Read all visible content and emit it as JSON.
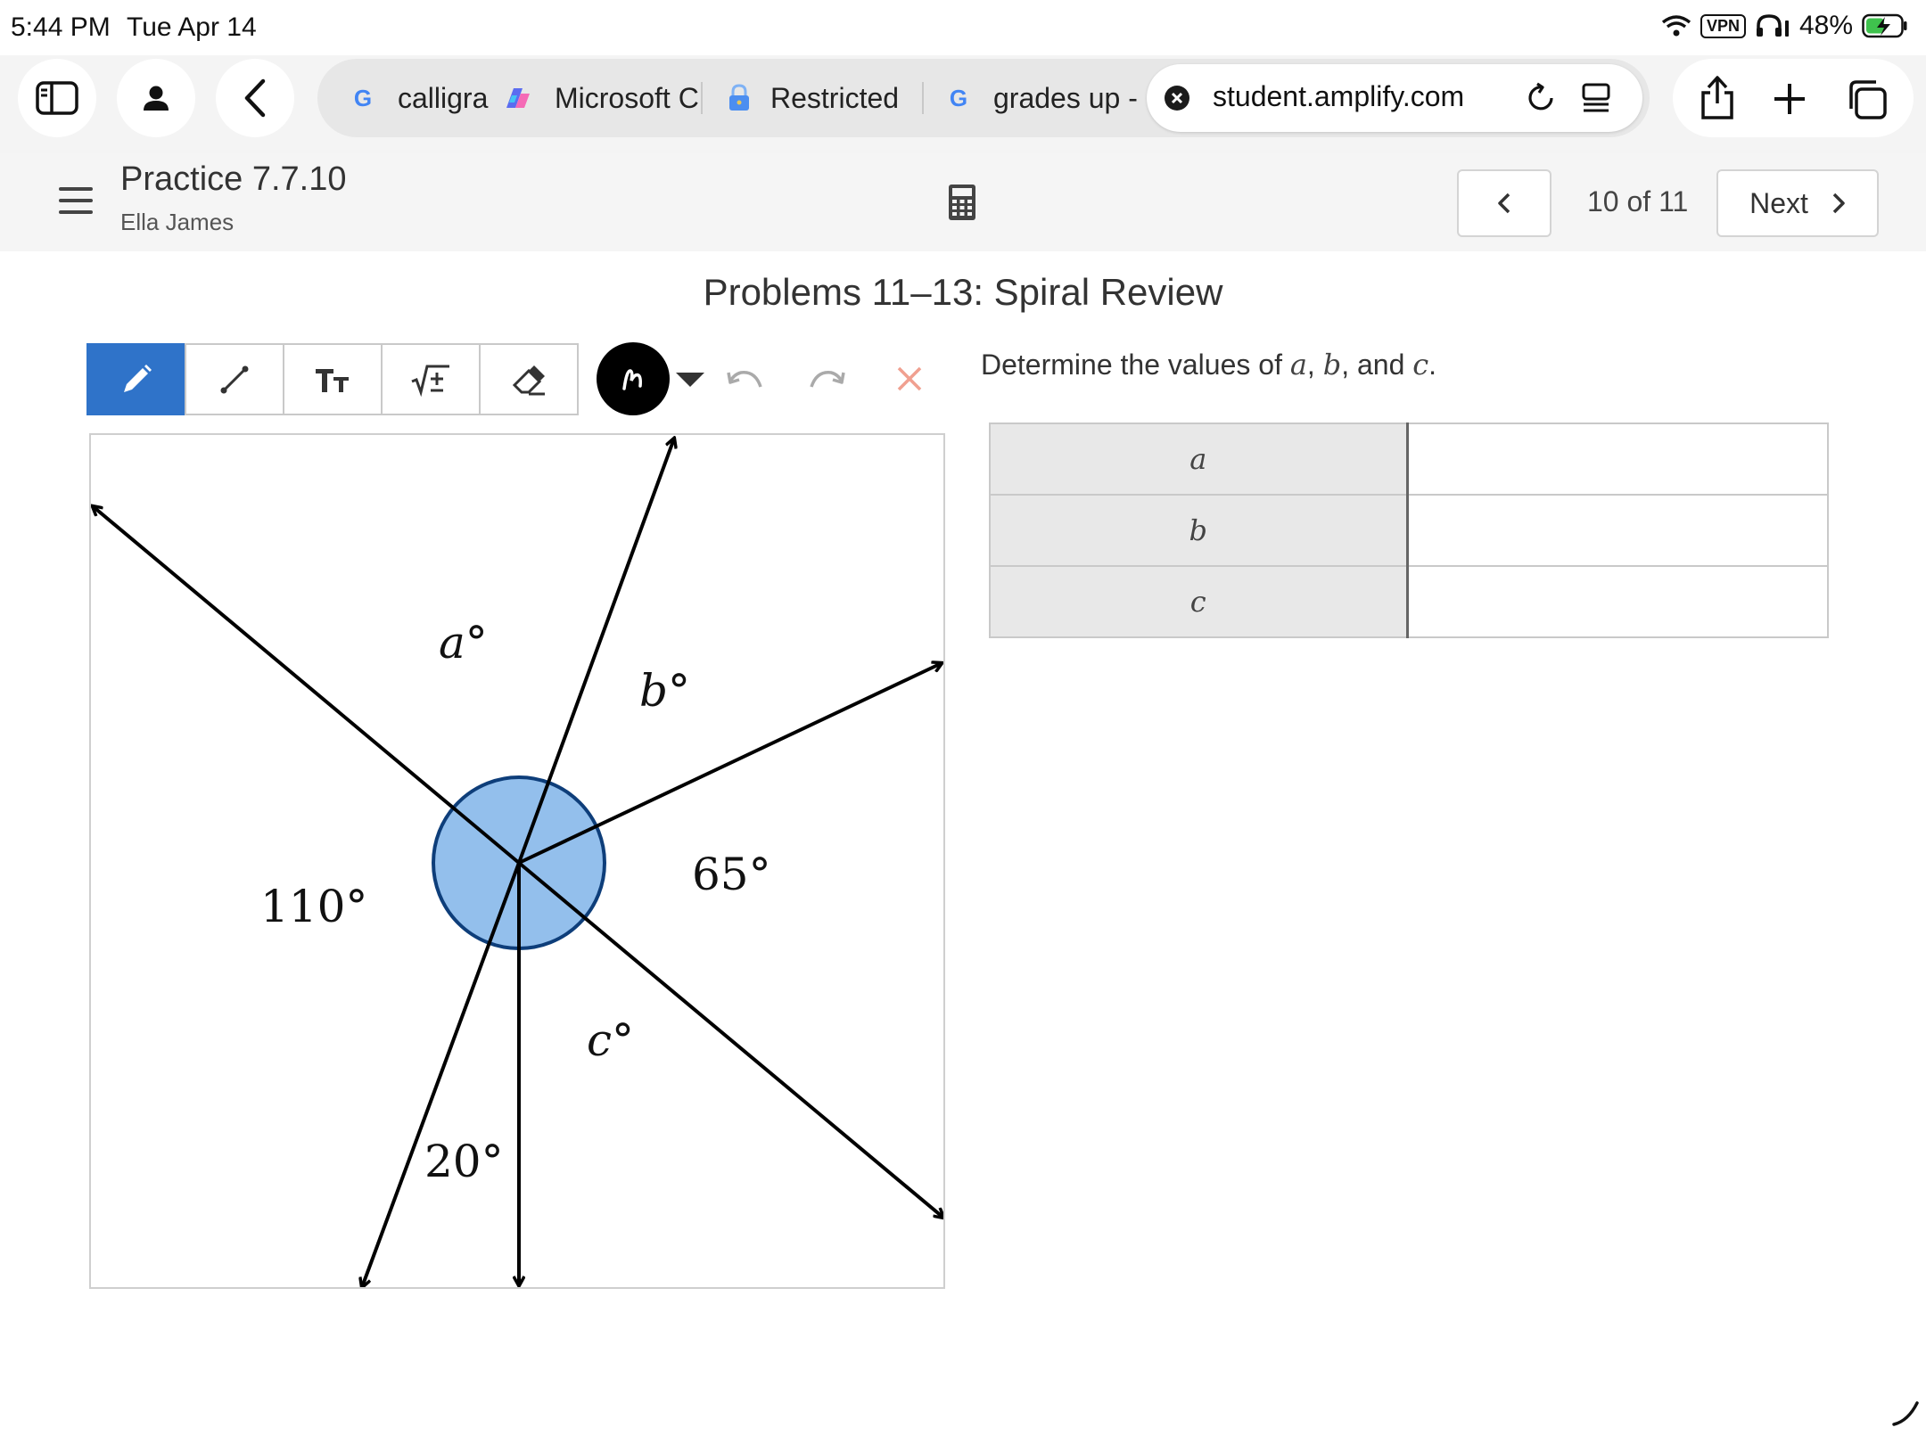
{
  "status_bar": {
    "time": "5:44 PM",
    "date": "Tue Apr 14",
    "vpn": "VPN",
    "battery": "48%"
  },
  "browser": {
    "tabs": [
      {
        "label": "calligra",
        "icon": "google-g-icon"
      },
      {
        "label": "Microsoft C",
        "icon": "copilot-icon"
      },
      {
        "label": "Restricted",
        "icon": "lock-icon"
      },
      {
        "label": "grades up -",
        "icon": "google-g-icon"
      }
    ],
    "active_tab": {
      "url": "student.amplify.com"
    }
  },
  "header": {
    "title": "Practice 7.7.10",
    "student": "Ella James",
    "page_counter": "10 of 11",
    "next_label": "Next"
  },
  "content": {
    "problem_title": "Problems 11–13: Spiral Review",
    "question": {
      "prefix": "Determine the values of",
      "var_a": "a",
      "sep1": ",",
      "var_b": "b",
      "sep2": ", and",
      "var_c": "c",
      "suffix": "."
    },
    "table": {
      "rows": [
        {
          "label": "a",
          "value": ""
        },
        {
          "label": "b",
          "value": ""
        },
        {
          "label": "c",
          "value": ""
        }
      ]
    }
  },
  "diagram": {
    "angle_labels": {
      "a": "a°",
      "b": "b°",
      "c": "c°",
      "angle_110": "110°",
      "angle_65": "65°",
      "angle_20": "20°"
    }
  },
  "colors": {
    "tool_active": "#2f73c9",
    "circle_fill": "#93bfec",
    "circle_stroke": "#0e3e7a",
    "clear_x": "#f0a090"
  }
}
